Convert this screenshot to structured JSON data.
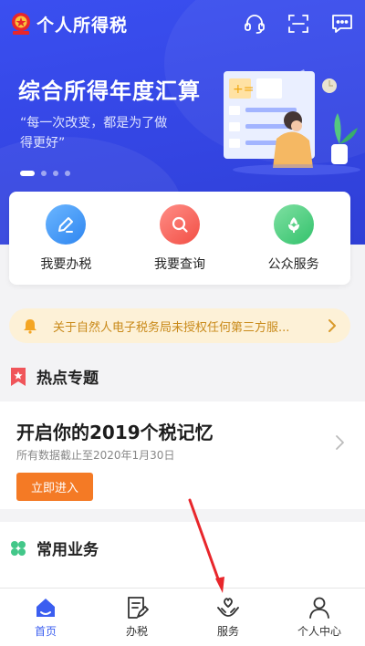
{
  "header": {
    "app_title": "个人所得税",
    "icons": [
      "headset-icon",
      "scan-icon",
      "message-icon"
    ]
  },
  "banner": {
    "title": "综合所得年度汇算",
    "quote": "“每一次改变，都是为了做得更好”",
    "slides": 4,
    "active_slide": 1
  },
  "quick_actions": [
    {
      "label": "我要办税",
      "icon": "edit-icon",
      "color": "#2f86f0"
    },
    {
      "label": "我要查询",
      "icon": "magnifier-icon",
      "color": "#f24f45"
    },
    {
      "label": "公众服务",
      "icon": "flower-icon",
      "color": "#33c26c"
    }
  ],
  "notice": {
    "text": "关于自然人电子税务局未授权任何第三方服..."
  },
  "hot_topics": {
    "section_title": "热点专题",
    "card_title": "开启你的2019个税记忆",
    "card_subtitle": "所有数据截止至2020年1月30日",
    "button_label": "立即进入"
  },
  "common_services": {
    "section_title": "常用业务"
  },
  "tabbar": {
    "items": [
      {
        "label": "首页",
        "icon": "home-icon",
        "active": true
      },
      {
        "label": "办税",
        "icon": "document-icon",
        "active": false
      },
      {
        "label": "服务",
        "icon": "heart-hands-icon",
        "active": false
      },
      {
        "label": "个人中心",
        "icon": "user-icon",
        "active": false
      }
    ]
  },
  "colors": {
    "brand_blue": "#3547e6",
    "accent_orange": "#f47a25",
    "notice_bg": "#fdf1d7",
    "annotation_red": "#e8262b"
  }
}
